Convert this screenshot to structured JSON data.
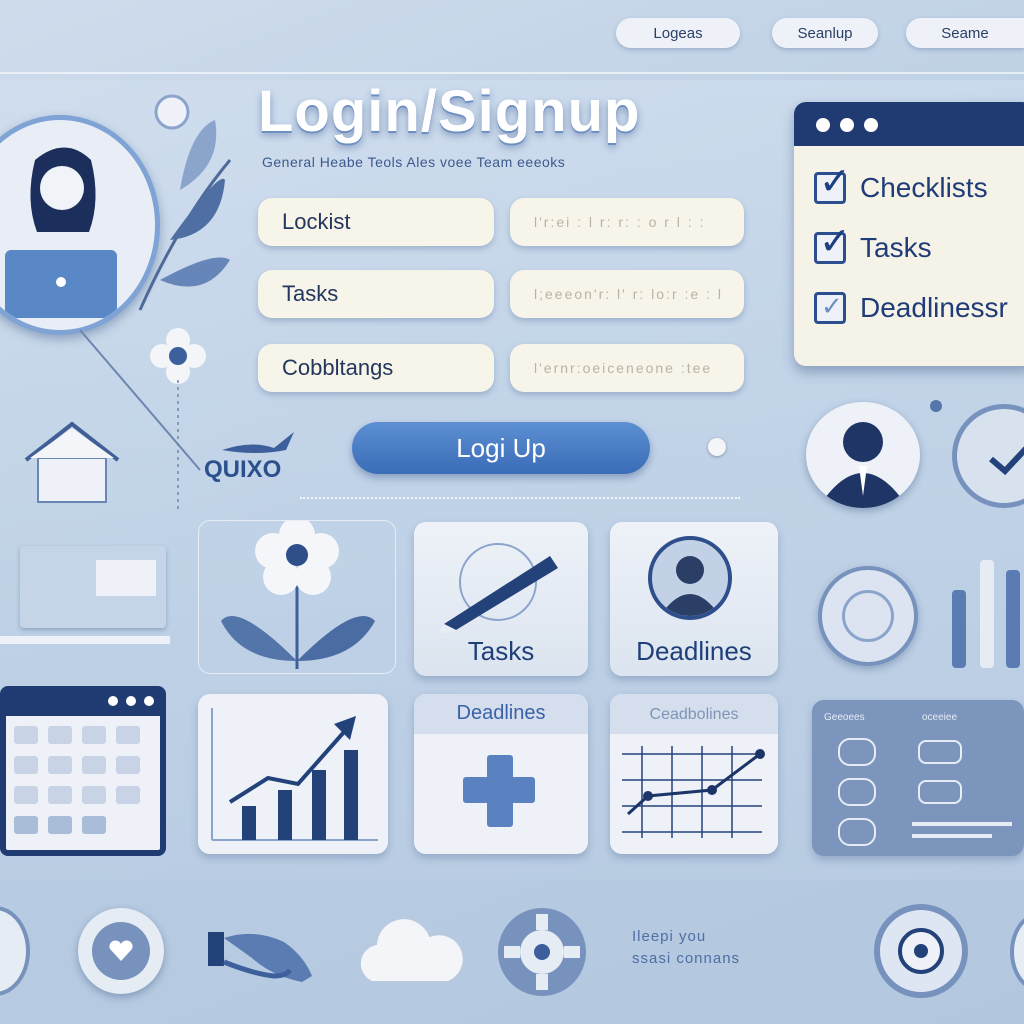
{
  "nav": {
    "btn1": "Logeas",
    "btn2": "Seanlup",
    "btn3": "Seame"
  },
  "auth": {
    "title": "Login/Signup",
    "subtitle": "General   Heabe   Teols Ales voee Team eeeoks",
    "fields": [
      {
        "label": "Lockist",
        "placeholder": "l'r:ei   : l   r: r: :  o r  l : :"
      },
      {
        "label": "Tasks",
        "placeholder": "l;eeeon'r: l' r: lo:r  :e  : l"
      },
      {
        "label": "Cobbltangs",
        "placeholder": "l'ernr:oeiceneone  :tee"
      }
    ],
    "submit": "Logi Up"
  },
  "brand": {
    "name": "QUIXO"
  },
  "checklist": {
    "items": [
      {
        "label": "Checklists",
        "checked": true
      },
      {
        "label": "Tasks",
        "checked": true
      },
      {
        "label": "Deadlinessr",
        "checked": false
      }
    ]
  },
  "cards": {
    "tasks": "Tasks",
    "deadlines": "Deadlines",
    "deadlines2": "Deadlines",
    "ceadlines": "Ceadbolines",
    "panel_hdr1": "Geeoees",
    "panel_hdr2": "oceeiee"
  },
  "footer": {
    "line1": "Ileepi you",
    "line2": "ssasi connans"
  },
  "colors": {
    "accent": "#3a6cb8",
    "navy": "#203a72",
    "field": "#f7f4ea"
  },
  "icons": [
    "user-laptop-icon",
    "flower-icon",
    "home-icon",
    "checkbox-icon",
    "user-avatar-icon",
    "clock-icon",
    "pencil-icon",
    "calendar-icon",
    "bar-chart-icon",
    "puzzle-icon",
    "line-chart-icon",
    "heart-icon",
    "handshake-icon",
    "cloud-icon",
    "gear-icon",
    "target-icon"
  ]
}
